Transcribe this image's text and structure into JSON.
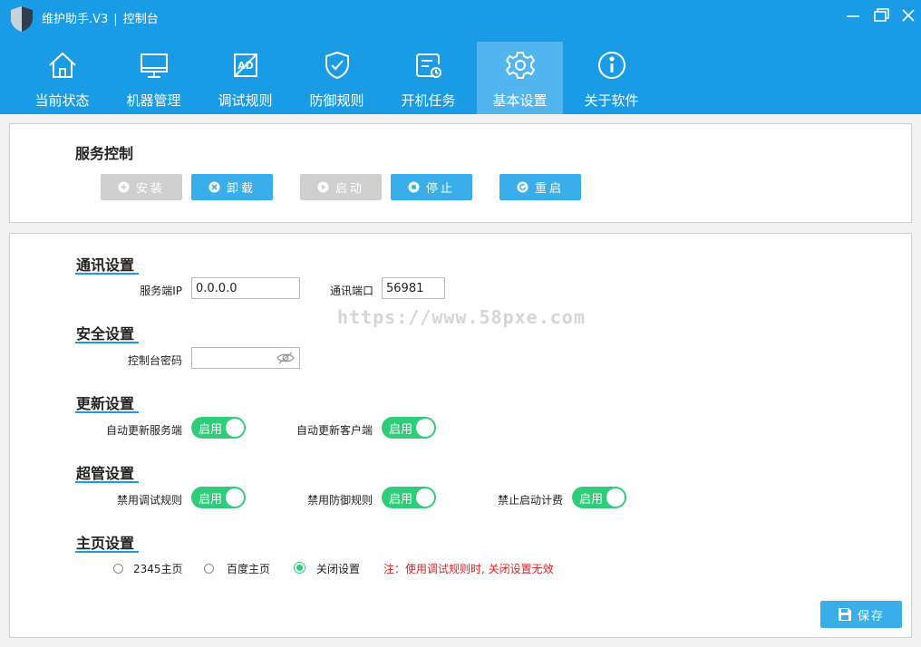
{
  "app": {
    "title": "维护助手.V3",
    "separator": "|",
    "subtitle": "控制台"
  },
  "window_controls": [
    "minimize-icon",
    "maximize-icon",
    "close-icon"
  ],
  "tabs": [
    {
      "label": "当前状态",
      "icon": "home-icon",
      "active": false
    },
    {
      "label": "机器管理",
      "icon": "monitor-icon",
      "active": false
    },
    {
      "label": "调试规则",
      "icon": "ad-block-icon",
      "active": false
    },
    {
      "label": "防御规则",
      "icon": "shield-check-icon",
      "active": false
    },
    {
      "label": "开机任务",
      "icon": "startup-task-icon",
      "active": false
    },
    {
      "label": "基本设置",
      "icon": "gear-icon",
      "active": true
    },
    {
      "label": "关于软件",
      "icon": "info-icon",
      "active": false
    }
  ],
  "service_control": {
    "title": "服务控制",
    "buttons": [
      {
        "label": "安装",
        "enabled": false,
        "icon": "plus-circle-icon"
      },
      {
        "label": "卸载",
        "enabled": true,
        "icon": "x-circle-icon"
      },
      {
        "label": "启动",
        "enabled": false,
        "icon": "play-circle-icon"
      },
      {
        "label": "停止",
        "enabled": true,
        "icon": "stop-circle-icon"
      },
      {
        "label": "重启",
        "enabled": true,
        "icon": "restart-icon"
      }
    ]
  },
  "comm": {
    "title": "通讯设置",
    "server_ip_label": "服务端IP",
    "server_ip_value": "0.0.0.0",
    "port_label": "通讯端口",
    "port_value": "56981"
  },
  "security": {
    "title": "安全设置",
    "password_label": "控制台密码",
    "password_value": ""
  },
  "update": {
    "title": "更新设置",
    "items": [
      {
        "label": "自动更新服务端",
        "state": "启用",
        "on": true
      },
      {
        "label": "自动更新客户端",
        "state": "启用",
        "on": true
      }
    ]
  },
  "superadmin": {
    "title": "超管设置",
    "items": [
      {
        "label": "禁用调试规则",
        "state": "启用",
        "on": true
      },
      {
        "label": "禁用防御规则",
        "state": "启用",
        "on": true
      },
      {
        "label": "禁止启动计费",
        "state": "启用",
        "on": true
      }
    ]
  },
  "homepage": {
    "title": "主页设置",
    "options": [
      {
        "label": "2345主页",
        "checked": false
      },
      {
        "label": "百度主页",
        "checked": false
      },
      {
        "label": "关闭设置",
        "checked": true
      }
    ],
    "note": "注：使用调试规则时, 关闭设置无效"
  },
  "save_label": "保存",
  "watermark": "https://www.58pxe.com",
  "colors": {
    "header": "#1a9be6",
    "active_tab": "#52b5ee",
    "button": "#3aaeea",
    "button_disabled": "#cfcfcf",
    "toggle_on": "#2fcc7a",
    "note": "#e02020"
  }
}
